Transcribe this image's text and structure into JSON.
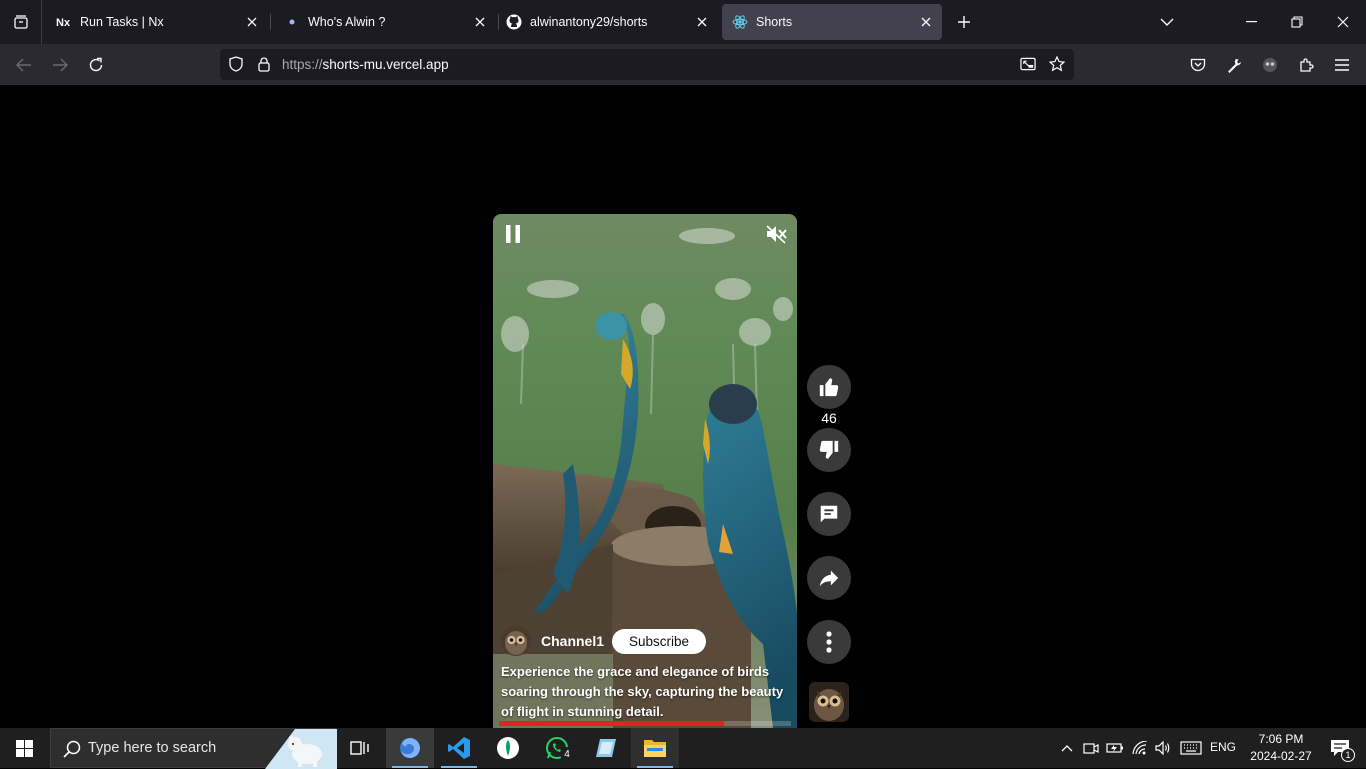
{
  "browser": {
    "tabs": [
      {
        "title": "Run Tasks | Nx",
        "active": false
      },
      {
        "title": "Who's Alwin ?",
        "active": false
      },
      {
        "title": "alwinantony29/shorts",
        "active": false
      },
      {
        "title": "Shorts",
        "active": true
      }
    ],
    "url_scheme": "https://",
    "url_host": "shorts-mu.vercel.app"
  },
  "short": {
    "channel_name": "Channel1",
    "subscribe_label": "Subscribe",
    "description": "Experience the grace and elegance of birds soaring through the sky, capturing the beauty of flight in stunning detail.",
    "like_count": "46",
    "progress_fraction": 0.77,
    "progress_color": "#e02424"
  },
  "actions": [
    "thumbs-up-icon",
    "thumbs-down-icon",
    "comment-icon",
    "share-icon",
    "more-icon"
  ],
  "taskbar": {
    "search_placeholder": "Type here to search",
    "whatsapp_badge": "4",
    "language": "ENG",
    "time": "7:06 PM",
    "date": "2024-02-27",
    "notification_count": "1"
  }
}
